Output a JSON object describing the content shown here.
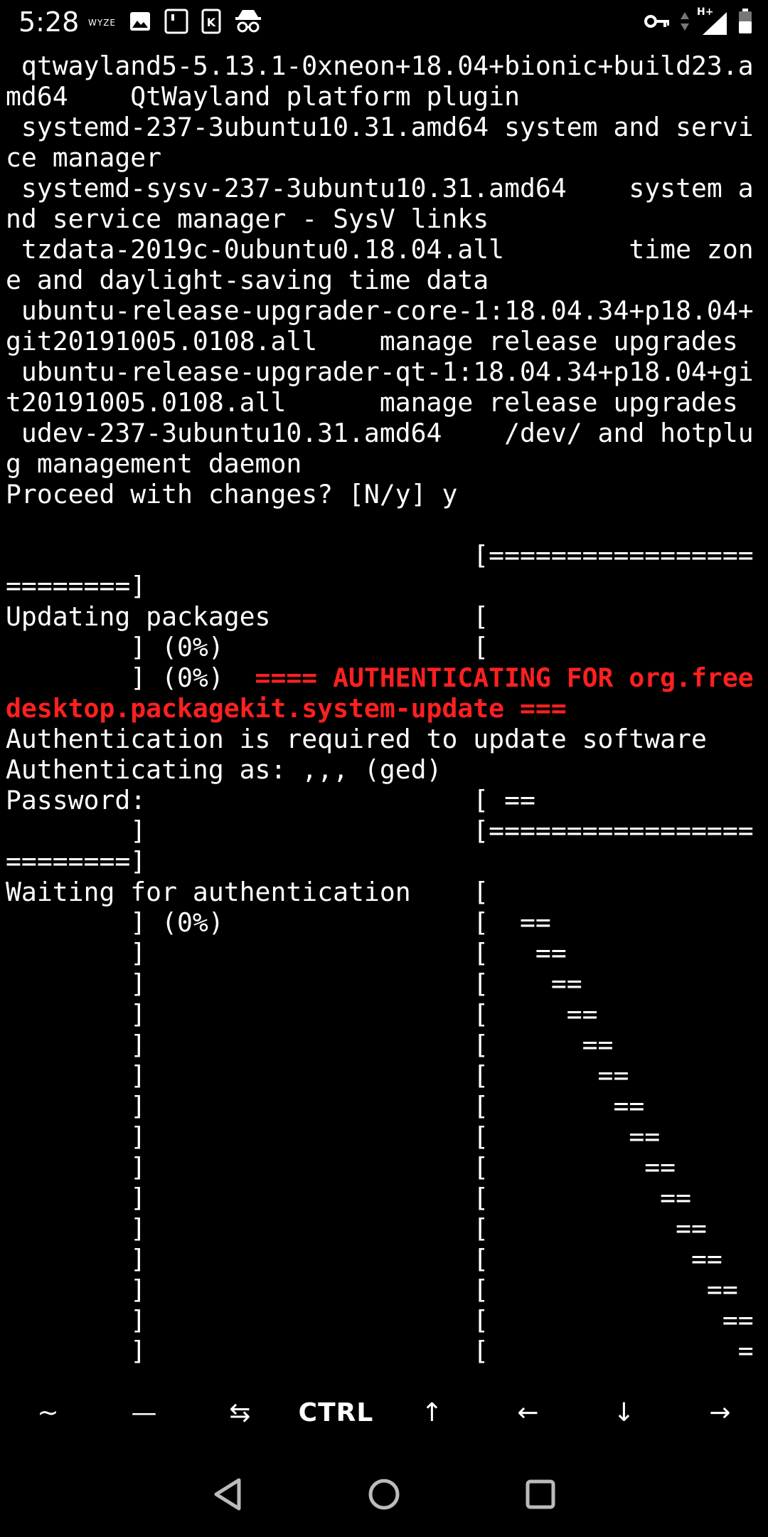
{
  "status_bar": {
    "time": "5:28",
    "wyze_label": "WYZE",
    "network_label": "H+",
    "left_icons": [
      "wyze-icon",
      "image-icon",
      "sd-card-icon",
      "k-app-icon",
      "incognito-icon"
    ],
    "right_icons": [
      "vpn-key-icon",
      "data-arrows-icon",
      "signal-icon",
      "battery-icon"
    ]
  },
  "terminal": {
    "lines": [
      {
        "text": " qtwayland5-5.13.1-0xneon+18.04+bionic+build23.a"
      },
      {
        "text": "md64    QtWayland platform plugin"
      },
      {
        "text": " systemd-237-3ubuntu10.31.amd64 system and servi"
      },
      {
        "text": "ce manager"
      },
      {
        "text": " systemd-sysv-237-3ubuntu10.31.amd64    system a"
      },
      {
        "text": "nd service manager - SysV links"
      },
      {
        "text": " tzdata-2019c-0ubuntu0.18.04.all        time zon"
      },
      {
        "text": "e and daylight-saving time data"
      },
      {
        "text": " ubuntu-release-upgrader-core-1:18.04.34+p18.04+"
      },
      {
        "text": "git20191005.0108.all    manage release upgrades"
      },
      {
        "text": " ubuntu-release-upgrader-qt-1:18.04.34+p18.04+gi"
      },
      {
        "text": "t20191005.0108.all      manage release upgrades"
      },
      {
        "text": " udev-237-3ubuntu10.31.amd64    /dev/ and hotplu"
      },
      {
        "text": "g management daemon"
      },
      {
        "text": "Proceed with changes? [N/y] y"
      },
      {
        "text": ""
      },
      {
        "text": "                              [================="
      },
      {
        "text": "========]"
      },
      {
        "text": "Updating packages             ["
      },
      {
        "text": "        ] (0%)                ["
      },
      {
        "text": "        ] (0%)  ",
        "red": "==== AUTHENTICATING FOR org.free"
      },
      {
        "text": "",
        "red": "desktop.packagekit.system-update ==="
      },
      {
        "text": "Authentication is required to update software"
      },
      {
        "text": "Authenticating as: ,,, (ged)"
      },
      {
        "text": "Password:                     [ =="
      },
      {
        "text": "        ]                     [================="
      },
      {
        "text": "========]"
      },
      {
        "text": "Waiting for authentication    ["
      },
      {
        "text": "        ] (0%)                [  =="
      },
      {
        "text": "        ]                     [   =="
      },
      {
        "text": "        ]                     [    =="
      },
      {
        "text": "        ]                     [     =="
      },
      {
        "text": "        ]                     [      =="
      },
      {
        "text": "        ]                     [       =="
      },
      {
        "text": "        ]                     [        =="
      },
      {
        "text": "        ]                     [         =="
      },
      {
        "text": "        ]                     [          =="
      },
      {
        "text": "        ]                     [           =="
      },
      {
        "text": "        ]                     [            =="
      },
      {
        "text": "        ]                     [             =="
      },
      {
        "text": "        ]                     [              =="
      },
      {
        "text": "        ]                     [               =="
      },
      {
        "text": "        ]                     [                ="
      }
    ]
  },
  "extra_keys": [
    {
      "label": "~",
      "name": "key-tilde"
    },
    {
      "label": "—",
      "name": "key-dash"
    },
    {
      "label": "⇆",
      "name": "key-tab"
    },
    {
      "label": "CTRL",
      "name": "key-ctrl"
    },
    {
      "label": "↑",
      "name": "key-up"
    },
    {
      "label": "←",
      "name": "key-left"
    },
    {
      "label": "↓",
      "name": "key-down"
    },
    {
      "label": "→",
      "name": "key-right"
    }
  ],
  "nav_bar": {
    "buttons": [
      "back-icon",
      "home-icon",
      "recents-icon"
    ]
  },
  "colors": {
    "background": "#000000",
    "text": "#ffffff",
    "auth_warning": "#ff2020"
  }
}
